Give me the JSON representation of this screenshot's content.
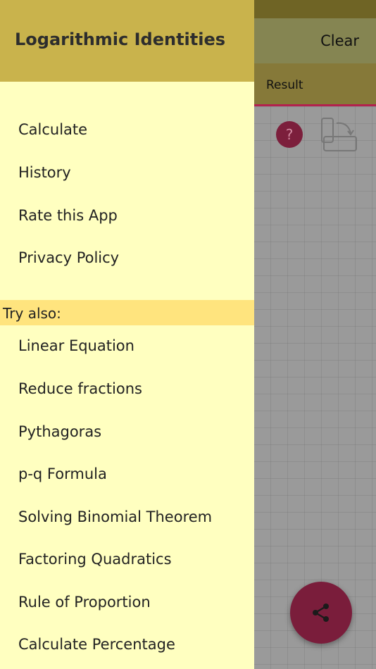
{
  "app": {
    "clear_label": "Clear",
    "tab_result_label": "Result",
    "help_label": "?"
  },
  "drawer": {
    "title": "Logarithmic Identities",
    "menu": [
      {
        "label": "Calculate"
      },
      {
        "label": "History"
      },
      {
        "label": "Rate this App"
      },
      {
        "label": "Privacy Policy"
      }
    ],
    "try_also_label": "Try also:",
    "try_also": [
      {
        "label": "Linear Equation"
      },
      {
        "label": "Reduce fractions"
      },
      {
        "label": "Pythagoras"
      },
      {
        "label": "p-q Formula"
      },
      {
        "label": "Solving Binomial Theorem"
      },
      {
        "label": "Factoring Quadratics"
      },
      {
        "label": "Rule of Proportion"
      },
      {
        "label": "Calculate Percentage"
      }
    ]
  },
  "colors": {
    "drawer_bg": "#ffffc0",
    "drawer_header": "#c9b34c",
    "try_also_band": "#ffe47e",
    "accent": "#b3224e"
  },
  "icons": {
    "help": "question-icon",
    "rotate": "rotate-device-icon",
    "share": "share-icon"
  }
}
